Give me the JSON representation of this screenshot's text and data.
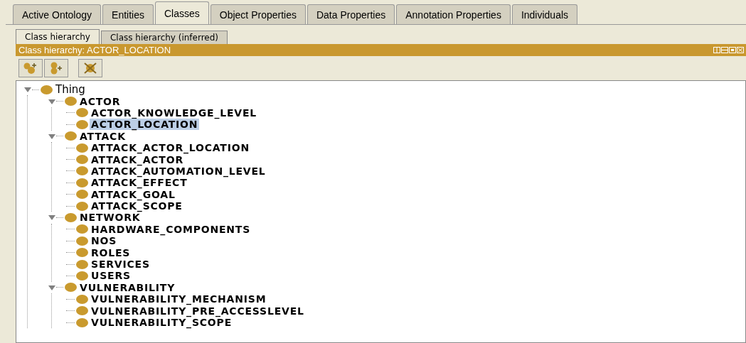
{
  "tabs": [
    {
      "label": "Active Ontology",
      "selected": false
    },
    {
      "label": "Entities",
      "selected": false
    },
    {
      "label": "Classes",
      "selected": true
    },
    {
      "label": "Object Properties",
      "selected": false
    },
    {
      "label": "Data Properties",
      "selected": false
    },
    {
      "label": "Annotation Properties",
      "selected": false
    },
    {
      "label": "Individuals",
      "selected": false
    }
  ],
  "view_tabs": [
    {
      "label": "Class hierarchy",
      "selected": true
    },
    {
      "label": "Class hierarchy (inferred)",
      "selected": false
    }
  ],
  "panel": {
    "title": "Class hierarchy: ACTOR_LOCATION"
  },
  "tree": [
    {
      "label": "Thing",
      "expanded": true,
      "selected": false,
      "children": [
        {
          "label": "ACTOR",
          "expanded": true,
          "selected": false,
          "children": [
            {
              "label": "ACTOR_KNOWLEDGE_LEVEL",
              "selected": false
            },
            {
              "label": "ACTOR_LOCATION",
              "selected": true
            }
          ]
        },
        {
          "label": "ATTACK",
          "expanded": true,
          "selected": false,
          "children": [
            {
              "label": "ATTACK_ACTOR_LOCATION",
              "selected": false
            },
            {
              "label": "ATTACK_ACTOR",
              "selected": false
            },
            {
              "label": "ATTACK_AUTOMATION_LEVEL",
              "selected": false
            },
            {
              "label": "ATTACK_EFFECT",
              "selected": false
            },
            {
              "label": "ATTACK_GOAL",
              "selected": false
            },
            {
              "label": "ATTACK_SCOPE",
              "selected": false
            }
          ]
        },
        {
          "label": "NETWORK",
          "expanded": true,
          "selected": false,
          "children": [
            {
              "label": "HARDWARE_COMPONENTS",
              "selected": false
            },
            {
              "label": "NOS",
              "selected": false
            },
            {
              "label": "ROLES",
              "selected": false
            },
            {
              "label": "SERVICES",
              "selected": false
            },
            {
              "label": "USERS",
              "selected": false
            }
          ]
        },
        {
          "label": "VULNERABILITY",
          "expanded": true,
          "selected": false,
          "children": [
            {
              "label": "VULNERABILITY_MECHANISM",
              "selected": false
            },
            {
              "label": "VULNERABILITY_PRE_ACCESSLEVEL",
              "selected": false
            },
            {
              "label": "VULNERABILITY_SCOPE",
              "selected": false
            }
          ]
        }
      ]
    }
  ]
}
